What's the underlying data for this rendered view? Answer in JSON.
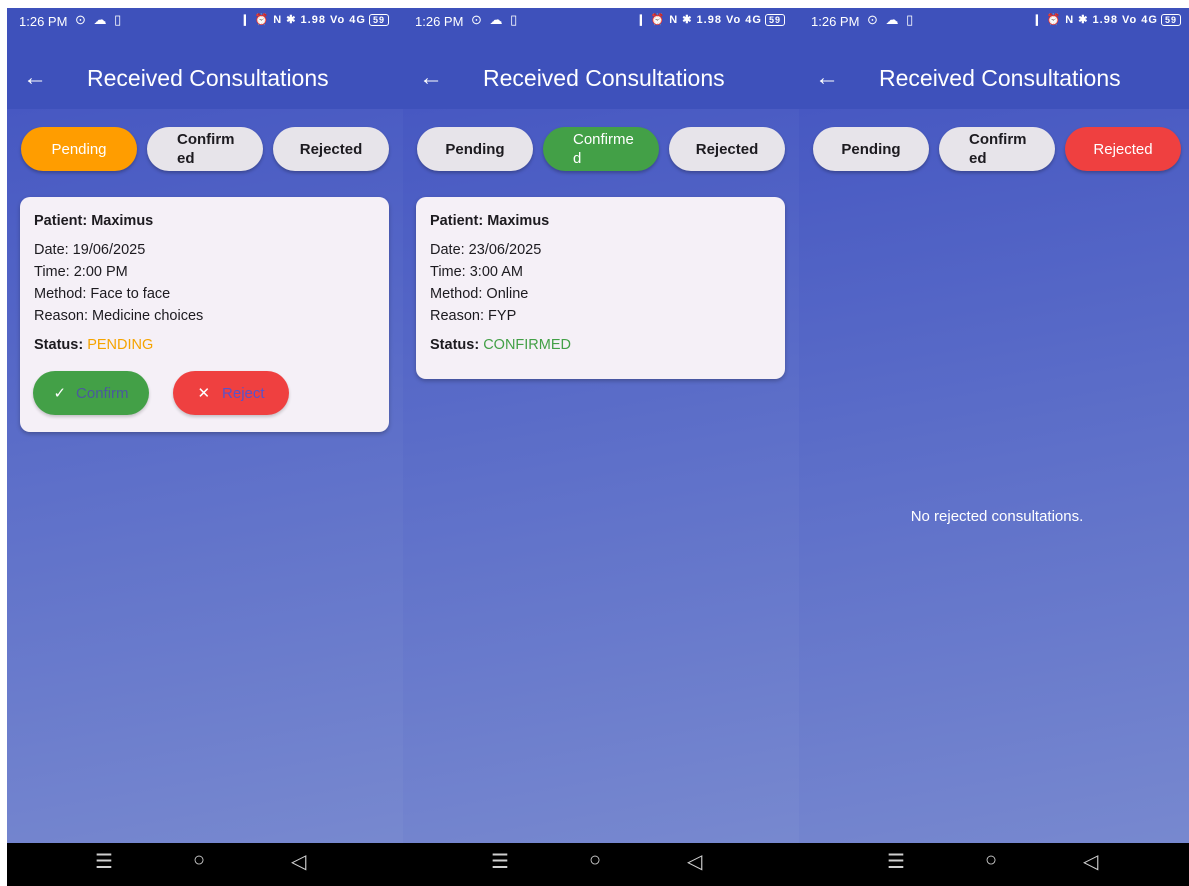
{
  "status_bar": {
    "time": "1:26 PM",
    "left_icons": "⊙ ☁ ▯",
    "right_icons": "❙ ⏰ N ✱ 1.98 Vo 4G",
    "battery": "59"
  },
  "app_bar": {
    "title": "Received Consultations"
  },
  "tabs": {
    "pending": "Pending",
    "confirmed": "Confirmed",
    "rejected": "Rejected"
  },
  "screen1": {
    "active_tab": "Pending",
    "card": {
      "patient_label": "Patient: Maximus",
      "date": "Date: 19/06/2025",
      "time": "Time: 2:00 PM",
      "method": "Method: Face to face",
      "reason": "Reason: Medicine choices",
      "status_label": "Status:",
      "status_value": "PENDING"
    },
    "confirm_button": "Confirm",
    "reject_button": "Reject"
  },
  "screen2": {
    "active_tab": "Confirmed",
    "card": {
      "patient_label": "Patient: Maximus",
      "date": "Date: 23/06/2025",
      "time": "Time: 3:00 AM",
      "method": "Method: Online",
      "reason": "Reason: FYP",
      "status_label": "Status:",
      "status_value": "CONFIRMED"
    }
  },
  "screen3": {
    "active_tab": "Rejected",
    "empty_message": "No rejected consultations."
  },
  "colors": {
    "app_bar": "#3e51bb",
    "pending": "#ff9d00",
    "confirmed": "#43a047",
    "rejected": "#ef4040"
  },
  "icons": {
    "back": "arrow-left",
    "check": "check",
    "close": "x",
    "nav": [
      "menu",
      "home-circle",
      "back-triangle"
    ]
  }
}
